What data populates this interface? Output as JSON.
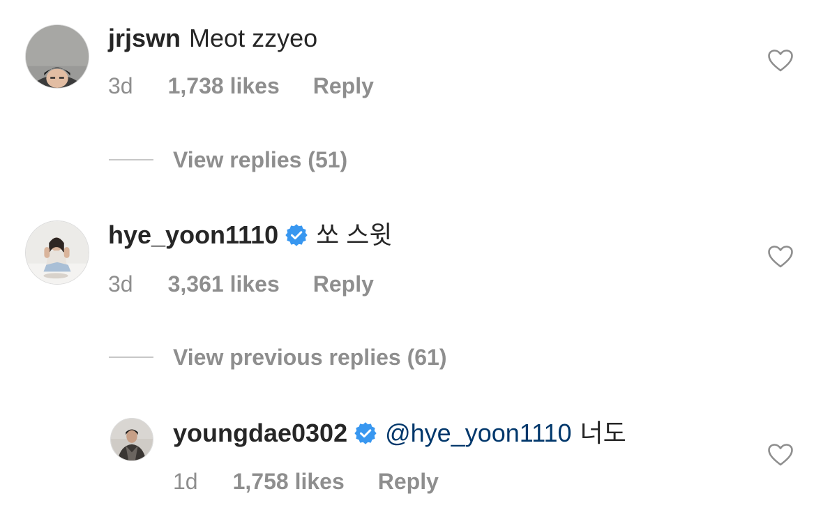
{
  "comments": [
    {
      "username": "jrjswn",
      "verified": false,
      "text": "Meot zzyeo",
      "time": "3d",
      "likes": "1,738 likes",
      "reply_label": "Reply",
      "view_replies": "View replies (51)"
    },
    {
      "username": "hye_yoon1110",
      "verified": true,
      "text": "쏘 스윗",
      "time": "3d",
      "likes": "3,361 likes",
      "reply_label": "Reply",
      "view_replies": "View previous replies (61)"
    }
  ],
  "reply": {
    "username": "youngdae0302",
    "verified": true,
    "mention": "@hye_yoon1110",
    "text": "너도",
    "time": "1d",
    "likes": "1,758 likes",
    "reply_label": "Reply"
  },
  "colors": {
    "verified_badge": "#3897f0",
    "mention": "#00376b",
    "secondary_text": "#8e8e8e"
  },
  "icons": {
    "like": "heart-outline-icon",
    "verified": "verified-badge-icon"
  }
}
